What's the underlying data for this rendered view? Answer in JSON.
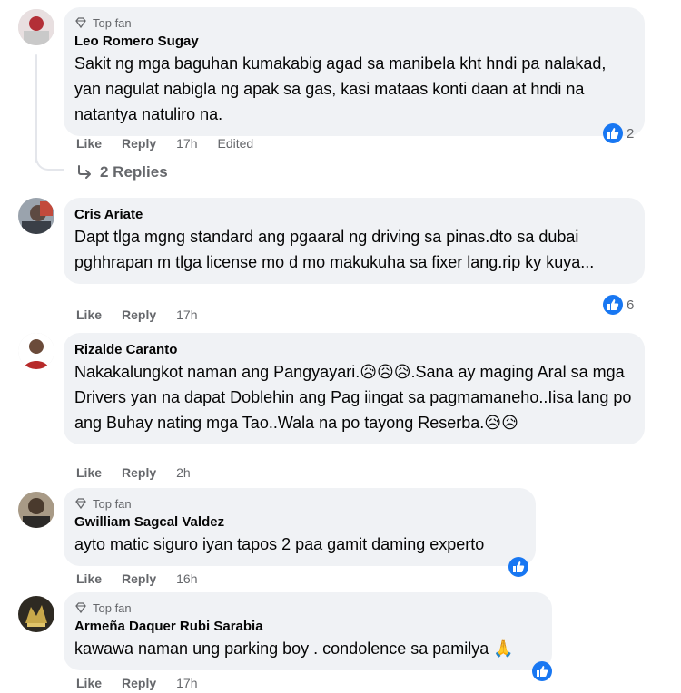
{
  "comments": [
    {
      "top_fan": true,
      "badge_label": "Top fan",
      "author": "Leo Romero Sugay",
      "text": "Sakit ng mga baguhan kumakabig agad sa manibela kht hndi pa nalakad, yan nagulat nabigla ng apak sa gas, kasi mataas konti daan at hndi na natantya natuliro na.",
      "like_label": "Like",
      "reply_label": "Reply",
      "time": "17h",
      "edited": "Edited",
      "reaction_count": "2",
      "replies_label": "2 Replies"
    },
    {
      "top_fan": false,
      "author": "Cris Ariate",
      "text": "Dapt tlga mgng standard ang pgaaral ng driving sa pinas.dto sa dubai pghhrapan m tlga license mo d mo makukuha sa fixer lang.rip ky kuya...",
      "like_label": "Like",
      "reply_label": "Reply",
      "time": "17h",
      "reaction_count": "6"
    },
    {
      "top_fan": false,
      "author": "Rizalde Caranto",
      "text": "Nakakalungkot naman ang Pangyayari.😥😥😥.Sana ay maging Aral sa mga Drivers yan na dapat Doblehin ang Pag iingat sa pagmamaneho..Iisa lang po ang Buhay nating mga Tao..Wala na po tayong Reserba.😥😥",
      "like_label": "Like",
      "reply_label": "Reply",
      "time": "2h"
    },
    {
      "top_fan": true,
      "badge_label": "Top fan",
      "author": "Gwilliam Sagcal Valdez",
      "text": "ayto matic siguro iyan tapos 2 paa gamit daming experto",
      "like_label": "Like",
      "reply_label": "Reply",
      "time": "16h"
    },
    {
      "top_fan": true,
      "badge_label": "Top fan",
      "author": "Armeña Daquer Rubi Sarabia",
      "text": "kawawa naman ung parking boy . condolence sa pamilya 🙏",
      "like_label": "Like",
      "reply_label": "Reply",
      "time": "17h"
    }
  ],
  "colors": {
    "bubble": "#f0f2f5",
    "meta": "#65676b",
    "like_blue": "#1877f2"
  }
}
